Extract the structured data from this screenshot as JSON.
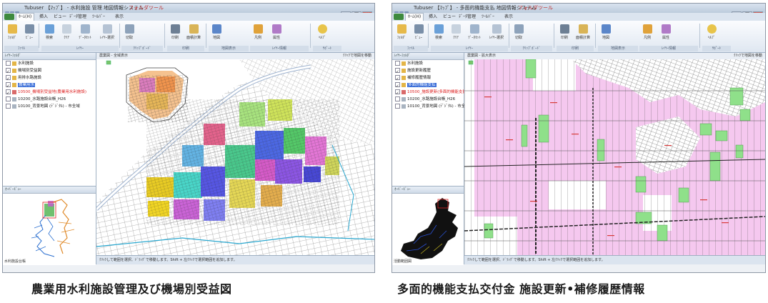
{
  "captions": {
    "left": "農業用水利施設管理及び機場別受益図",
    "right": "多面的機能支払交付金 施設更新•補修履歴情報"
  },
  "screens": [
    {
      "window_title": "Tubuser 【ﾏｯﾌﾟ】 - 水利施設 管理 地図情報システム",
      "context_title": "フォルダツール",
      "tabs": [
        "ﾎｰﾑ(H)",
        "挿入",
        "ビュー",
        "ﾃﾞｰﾀ管理",
        "ﾂｰﾙﾊﾞｰ",
        "表示"
      ],
      "ribbon_buttons": [
        "ﾌｫﾙﾀﾞ",
        "ﾋﾞｭｰ",
        "検索",
        "ｸﾘｱ",
        "ﾃﾞｰﾀｾｯﾄ",
        "ﾚｲﾔｰ選択",
        "切取",
        "印刷",
        "面積計算",
        "地図",
        "凡例",
        "属性",
        "ﾍﾙﾌﾟ"
      ],
      "ribbon_groups": [
        "ﾌｧｲﾙ",
        "ﾚｲﾔｰ",
        "ｸﾘｯﾌﾟﾎﾞｰﾄﾞ",
        "印刷",
        "計測",
        "地図表示",
        "ﾚｲﾔｰ情報",
        "ｻﾎﾟｰﾄ"
      ],
      "layers_header": "ﾚｲﾔｰﾌｫﾙﾀﾞ",
      "layers": [
        {
          "label": "水利施設",
          "checked": false,
          "red": false,
          "selected": false
        },
        {
          "label": "機場別受益図",
          "checked": true,
          "red": false,
          "selected": false
        },
        {
          "label": "用排水路施設",
          "checked": true,
          "red": false,
          "selected": false
        },
        {
          "label": "農業用水",
          "checked": true,
          "red": false,
          "selected": true
        },
        {
          "label": "10500_機場別受益地(農業用水利施設)",
          "checked": true,
          "red": true,
          "selected": false
        },
        {
          "label": "10200_水路施設台帳_H26",
          "checked": false,
          "red": false,
          "selected": false
        },
        {
          "label": "10100_背景地図 (ﾃﾞｼﾞﾀﾙ) - 市全域",
          "checked": false,
          "red": false,
          "selected": false
        }
      ],
      "overview_header": "ｵｰﾊﾞｰﾋﾞｭｰ",
      "overview_caption": "水利施設台帳",
      "map_header": "農業図 - 全域表示",
      "map_checkbox": "ｸﾘｯｸで地図を移動",
      "status_text": "ｸﾘｯｸして範囲を選択、ﾄﾞﾗｯｸﾞで移動します。Shift + 左ｸﾘｯｸで選択範囲を追加します。"
    },
    {
      "window_title": "Tubuser 【ﾏｯﾌﾟ】 - 多面的機能支払 地図情報システム",
      "context_title": "フォルダツール",
      "tabs": [
        "ﾎｰﾑ(H)",
        "挿入",
        "ビュー",
        "ﾃﾞｰﾀ管理",
        "ﾂｰﾙﾊﾞｰ",
        "表示"
      ],
      "ribbon_buttons": [
        "ﾌｫﾙﾀﾞ",
        "ﾋﾞｭｰ",
        "検索",
        "ｸﾘｱ",
        "ﾃﾞｰﾀｾｯﾄ",
        "ﾚｲﾔｰ選択",
        "切取",
        "印刷",
        "面積計算",
        "地図",
        "凡例",
        "属性",
        "ﾍﾙﾌﾟ"
      ],
      "ribbon_groups": [
        "ﾌｧｲﾙ",
        "ﾚｲﾔｰ",
        "ｸﾘｯﾌﾟﾎﾞｰﾄﾞ",
        "印刷",
        "計測",
        "地図表示",
        "ﾚｲﾔｰ情報",
        "ｻﾎﾟｰﾄ"
      ],
      "layers_header": "ﾚｲﾔｰﾌｫﾙﾀﾞ",
      "layers": [
        {
          "label": "水利施設",
          "checked": false,
          "red": false,
          "selected": false
        },
        {
          "label": "施設更新履歴",
          "checked": true,
          "red": false,
          "selected": false
        },
        {
          "label": "補修履歴情報",
          "checked": true,
          "red": false,
          "selected": false
        },
        {
          "label": "多面的機能支払",
          "checked": true,
          "red": false,
          "selected": true
        },
        {
          "label": "10500_施設更新(多面的機能支払交付金)",
          "checked": true,
          "red": true,
          "selected": false
        },
        {
          "label": "10200_水路施設台帳_H26",
          "checked": false,
          "red": false,
          "selected": false
        },
        {
          "label": "10100_背景地図 (ﾃﾞｼﾞﾀﾙ) - 市全域",
          "checked": false,
          "red": false,
          "selected": false
        }
      ],
      "overview_header": "ｵｰﾊﾞｰﾋﾞｭｰ",
      "overview_caption": "活動範囲図",
      "map_header": "農業図 - 拡大表示",
      "map_checkbox": "ｸﾘｯｸで地図を移動",
      "status_text": "ｸﾘｯｸして範囲を選択、ﾄﾞﾗｯｸﾞで移動します。Shift + 左ｸﾘｯｸで選択範囲を追加します。"
    }
  ],
  "colors": {
    "ribbon_bg": "#e4ebf4",
    "pink_parcel": "#f5c8ef",
    "green_parcel": "#8fe08a",
    "selection_blue": "#3a6ed8"
  }
}
